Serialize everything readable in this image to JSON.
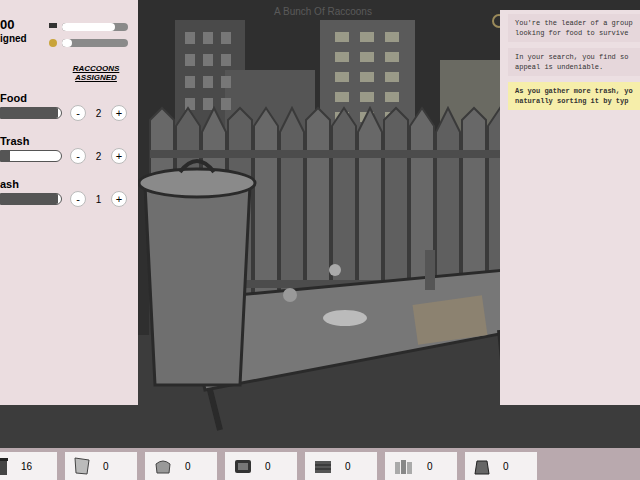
{
  "game": {
    "title": "A Bunch Of Raccoons"
  },
  "stats": {
    "count": "00",
    "label": "igned",
    "bars": [
      {
        "level": 0.8
      },
      {
        "level": 0.15
      }
    ]
  },
  "assign": {
    "header": "RACCOONS ASSIGNED",
    "minus": "-",
    "plus": "+",
    "jobs": [
      {
        "label": "Food",
        "count": "2",
        "level": 0.95
      },
      {
        "label": "Trash",
        "count": "2",
        "level": 0.15
      },
      {
        "label": "ash",
        "count": "1",
        "level": 0.95
      }
    ]
  },
  "log": [
    {
      "lines": [
        "You're the leader of a group",
        "looking for food to survive"
      ],
      "highlighted": false
    },
    {
      "lines": [
        "In your search, you find so",
        "appeal is undeniable."
      ],
      "highlighted": false
    },
    {
      "lines": [
        "As you gather more trash, yo",
        "naturally sorting it by typ"
      ],
      "highlighted": true
    }
  ],
  "inventory": [
    {
      "count": "16"
    },
    {
      "count": "0"
    },
    {
      "count": "0"
    },
    {
      "count": "0"
    },
    {
      "count": "0"
    },
    {
      "count": "0"
    },
    {
      "count": "0"
    }
  ]
}
